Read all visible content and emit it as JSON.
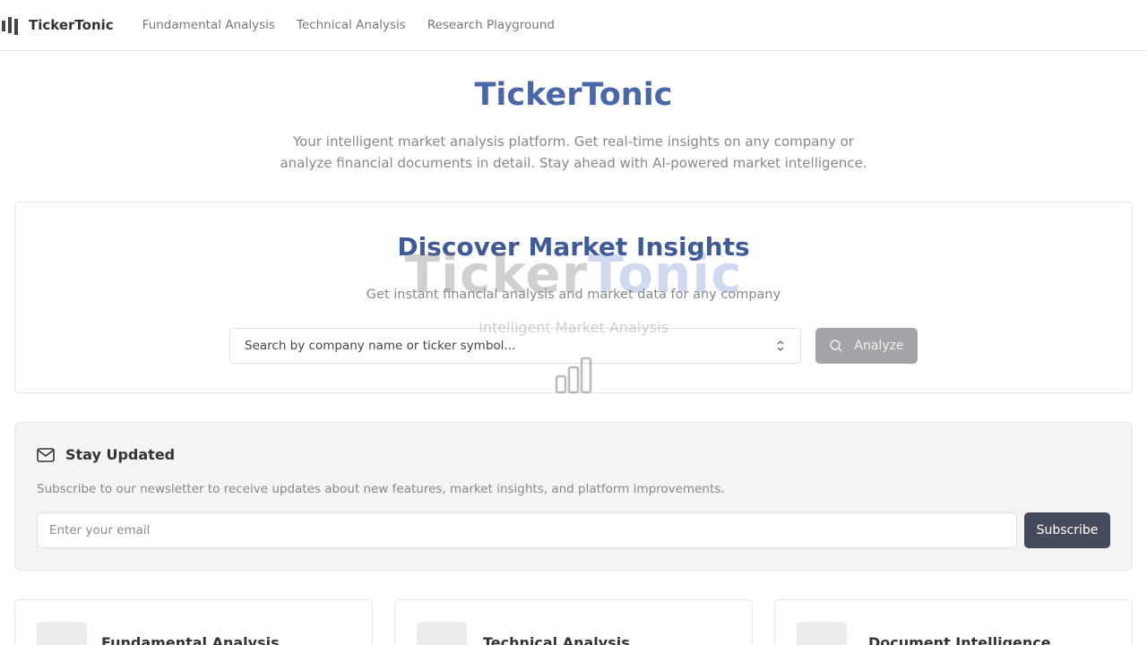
{
  "nav": {
    "brand": "TickerTonic",
    "links": [
      "Fundamental Analysis",
      "Technical Analysis",
      "Research Playground"
    ]
  },
  "hero": {
    "title": "TickerTonic",
    "subtitle": "Your intelligent market analysis platform. Get real-time insights on any company or analyze financial documents in detail. Stay ahead with AI-powered market intelligence."
  },
  "search_card": {
    "title": "Discover Market Insights",
    "subtitle": "Get instant financial analysis and market data for any company",
    "search_placeholder": "Search by company name or ticker symbol...",
    "analyze_label": "Analyze"
  },
  "overlay": {
    "title_part1": "Ticker",
    "title_part2": "Tonic",
    "subtitle": "Intelligent Market Analysis"
  },
  "newsletter": {
    "title": "Stay Updated",
    "description": "Subscribe to our newsletter to receive updates about new features, market insights, and platform improvements.",
    "email_placeholder": "Enter your email",
    "subscribe_label": "Subscribe"
  },
  "features": [
    {
      "label": "Fundamental Analysis"
    },
    {
      "label": "Technical Analysis"
    },
    {
      "label": "Document Intelligence"
    }
  ],
  "colors": {
    "brand_blue": "#4a67a8",
    "button_dark": "#454b5a",
    "button_disabled": "#a2a4a8"
  }
}
